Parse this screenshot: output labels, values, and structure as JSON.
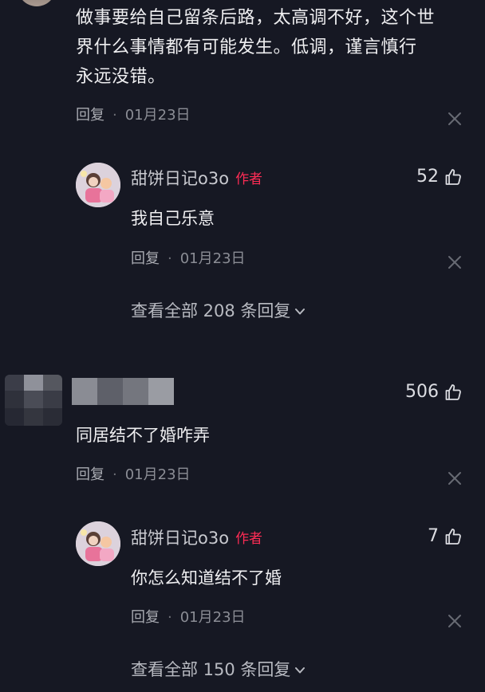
{
  "comment1": {
    "text_lines": [
      "做事要给自己留条后路，太高调不好，这个世",
      "界什么事情都有可能发生。低调，谨言慎行",
      "永远没错。"
    ],
    "reply_label": "回复",
    "date": "01月23日"
  },
  "reply1": {
    "author": "甜饼日记o3o",
    "author_tag": "作者",
    "likes": "52",
    "text": "我自己乐意",
    "reply_label": "回复",
    "date": "01月23日"
  },
  "view_more_1": {
    "label": "查看全部 208 条回复"
  },
  "comment2": {
    "likes": "506",
    "text": "同居结不了婚咋弄",
    "reply_label": "回复",
    "date": "01月23日"
  },
  "reply2": {
    "author": "甜饼日记o3o",
    "author_tag": "作者",
    "likes": "7",
    "text": "你怎么知道结不了婚",
    "reply_label": "回复",
    "date": "01月23日"
  },
  "view_more_2": {
    "label": "查看全部 150 条回复"
  },
  "colors": {
    "background": "#161823",
    "author_tag": "#ff2c55",
    "meta": "#8b8d95"
  },
  "icons": [
    "thumb-up-icon",
    "close-icon",
    "chevron-down-icon"
  ]
}
